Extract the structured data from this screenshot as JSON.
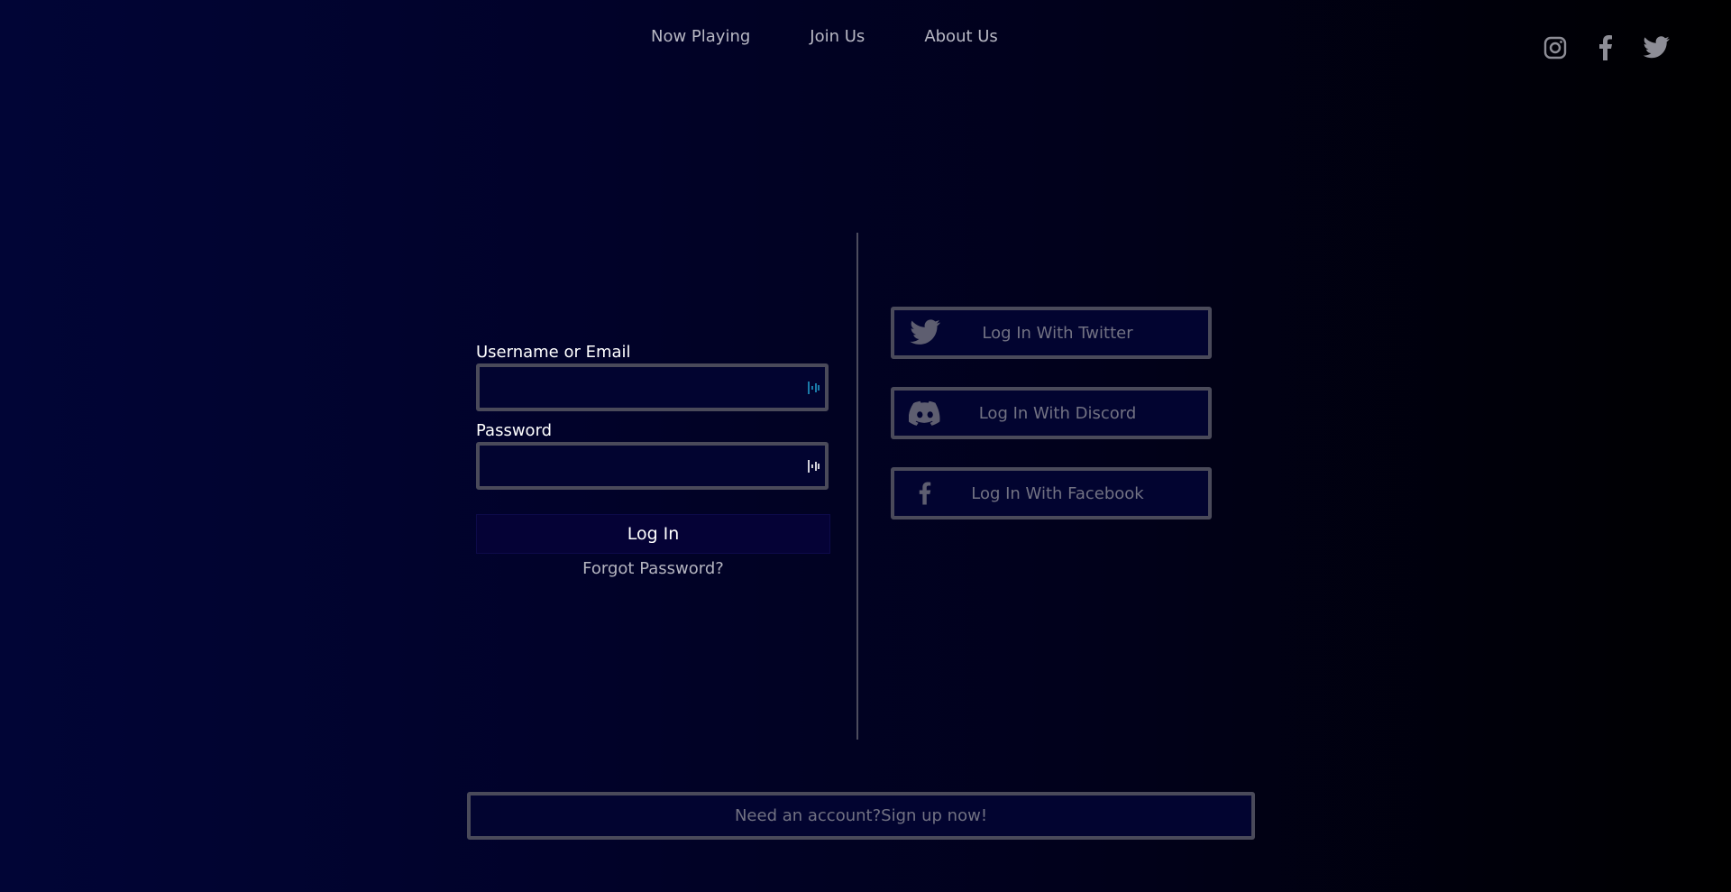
{
  "nav": {
    "items": [
      {
        "label": "Now Playing"
      },
      {
        "label": "Join Us"
      },
      {
        "label": "About Us"
      }
    ]
  },
  "social": {
    "icons": [
      "instagram-icon",
      "facebook-icon",
      "twitter-icon"
    ],
    "icon_color": "#8d8d96"
  },
  "form": {
    "username_label": "Username or Email",
    "username_value": "",
    "password_label": "Password",
    "password_value": "",
    "login_label": "Log In",
    "forgot_label": "Forgot Password?"
  },
  "oauth": {
    "twitter_label": "Log In With Twitter",
    "discord_label": "Log In With Discord",
    "facebook_label": "Log In With Facebook"
  },
  "signup": {
    "label": "Need an account?Sign up now!"
  },
  "colors": {
    "border": "#4a4a5a",
    "muted_text": "#727283",
    "field_bg": "#020430",
    "accent_icon": "#1a7aa8"
  }
}
